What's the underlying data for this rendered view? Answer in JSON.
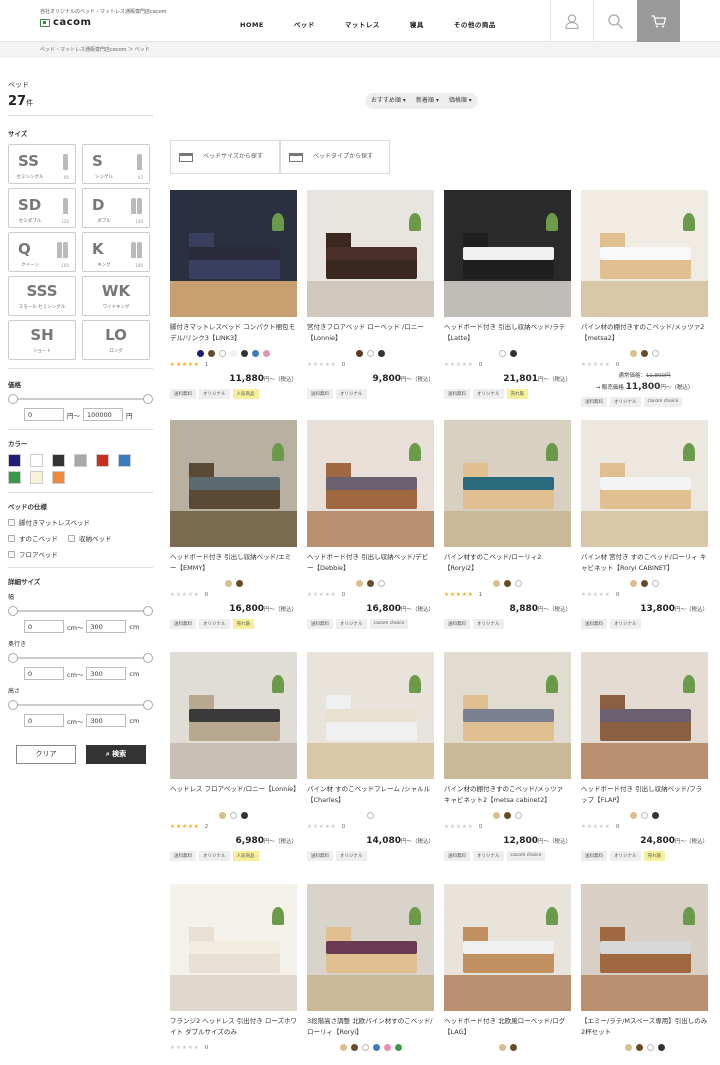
{
  "header": {
    "tagline": "自社オリジナルのベッド・マットレス通販専門店cacom",
    "logo": "cacom",
    "nav": [
      "HOME",
      "ベッド",
      "マットレス",
      "寝具",
      "その他の商品"
    ]
  },
  "breadcrumb": "ベッド・マットレス通販専門店cacom  ＞  ベッド",
  "sidebar": {
    "title": "ベッド",
    "count": "27",
    "count_unit": "件",
    "size_label": "サイズ",
    "sizes": [
      {
        "code": "SS",
        "desc": "セミシングル",
        "dim": "90",
        "people": 1
      },
      {
        "code": "S",
        "desc": "シングル",
        "dim": "97",
        "people": 1
      },
      {
        "code": "SD",
        "desc": "セミダブル",
        "dim": "120",
        "people": 1
      },
      {
        "code": "D",
        "desc": "ダブル",
        "dim": "140",
        "people": 2
      },
      {
        "code": "Q",
        "desc": "クイーン",
        "dim": "160",
        "people": 2
      },
      {
        "code": "K",
        "desc": "キング",
        "dim": "180",
        "people": 2
      },
      {
        "code": "SSS",
        "desc": "スモール セミシングル",
        "dim": "",
        "people": 0
      },
      {
        "code": "WK",
        "desc": "ワイドキング",
        "dim": "",
        "people": 0
      },
      {
        "code": "SH",
        "desc": "ショート",
        "dim": "",
        "people": 0
      },
      {
        "code": "LO",
        "desc": "ロング",
        "dim": "",
        "people": 0
      }
    ],
    "price_label": "価格",
    "price_min": "0",
    "price_sep": "円〜",
    "price_max": "100000",
    "price_unit": "円",
    "color_label": "カラー",
    "colors": [
      "#1f1f7a",
      "#ffffff",
      "#333333",
      "#a8a8a8",
      "#c83020",
      "#3a7cc0",
      "#3a9a4a",
      "#f8f2d8",
      "#f08a3a"
    ],
    "spec_label": "ベッドの仕様",
    "specs": [
      "脚付きマットレスベッド",
      "すのこベッド",
      "収納ベッド",
      "フロアベッド"
    ],
    "detail_label": "詳細サイズ",
    "dims": [
      {
        "label": "幅",
        "min": "0",
        "sep": "cm〜",
        "max": "300",
        "unit": "cm"
      },
      {
        "label": "奥行き",
        "min": "0",
        "sep": "cm〜",
        "max": "300",
        "unit": "cm"
      },
      {
        "label": "高さ",
        "min": "0",
        "sep": "cm〜",
        "max": "300",
        "unit": "cm"
      }
    ],
    "clear": "クリア",
    "search": "検索"
  },
  "sort": [
    "おすすめ順",
    "新着順",
    "価格順"
  ],
  "pills": [
    "ベッドサイズから探す",
    "ベッドタイプから探す"
  ],
  "products": [
    {
      "title": "脚付きマットレスベッド コンパクト梱包モデル/リンク3【LINK3】",
      "dots": [
        "#1f1f7a",
        "#6b4a2a",
        "#ffffff",
        "#f0f0f0",
        "#333333",
        "#3a7cc0",
        "#e890b0"
      ],
      "stars": 5,
      "reviews": "1",
      "price": "11,880",
      "tags": [
        "送料無料",
        "オリジナル",
        "人気商品"
      ],
      "room": "#2b3040",
      "floor": "#c8a070",
      "bedc": "#3a3f60",
      "matc": "#2a2a3a"
    },
    {
      "title": "宮付きフロアベッド ローベッド /ロニー【Lonnie】",
      "dots": [
        "#5a3a20",
        "#ffffff",
        "#333333"
      ],
      "stars": 0,
      "reviews": "0",
      "price": "9,800",
      "tags": [
        "送料無料",
        "オリジナル"
      ],
      "room": "#e8e4df",
      "floor": "#d0c8bd",
      "bedc": "#3a2820",
      "matc": "#4a3028"
    },
    {
      "title": "ヘッドボード付き 引出し収納ベッド/ラテ【Latte】",
      "dots": [
        "#ffffff",
        "#333333"
      ],
      "stars": 0,
      "reviews": "0",
      "price": "21,801",
      "tags": [
        "送料無料",
        "オリジナル",
        "売れ筋"
      ],
      "room": "#2a2a2a",
      "floor": "#c0bcb8",
      "bedc": "#1f1f1f",
      "matc": "#f0f0f0"
    },
    {
      "title": "パイン材の棚付きすのこベッド/メッツァ2【metsa2】",
      "dots": [
        "#d8c090",
        "#6b4a2a",
        "#ffffff"
      ],
      "stars": 0,
      "reviews": "0",
      "price": "",
      "orig_label": "通常価格：",
      "orig": "11,800円",
      "sale_label": "→ 販売価格",
      "sale": "11,800",
      "tags": [
        "送料無料",
        "オリジナル",
        "cacom choice"
      ],
      "room": "#f0ece4",
      "floor": "#d8c8a8",
      "bedc": "#e0c090",
      "matc": "#f8f8f8"
    },
    {
      "title": "ヘッドボード付き 引出し収納ベッド/エミー【EMMY】",
      "dots": [
        "#d8c090",
        "#6b4a2a"
      ],
      "stars": 0,
      "reviews": "0",
      "price": "16,800",
      "tags": [
        "送料無料",
        "オリジナル",
        "売れ筋"
      ],
      "room": "#b8b0a0",
      "floor": "#7a6a50",
      "bedc": "#5a4a35",
      "matc": "#5a6a70"
    },
    {
      "title": "ヘッドボード付き 引出し収納ベッド/デビー【Debbie】",
      "dots": [
        "#d8c090",
        "#6b4a2a",
        "#ffffff"
      ],
      "stars": 0,
      "reviews": "0",
      "price": "16,800",
      "tags": [
        "送料無料",
        "オリジナル",
        "cacom choice"
      ],
      "room": "#e8e0d8",
      "floor": "#b89070",
      "bedc": "#a06840",
      "matc": "#6a6070"
    },
    {
      "title": "パイン材すのこベッド/ローリィ2【Roryi2】",
      "dots": [
        "#d8c090",
        "#6b4a2a",
        "#ffffff"
      ],
      "stars": 5,
      "reviews": "1",
      "price": "8,880",
      "tags": [
        "送料無料",
        "オリジナル"
      ],
      "room": "#d8d0c0",
      "floor": "#c8b898",
      "bedc": "#e0c090",
      "matc": "#2a6a7a"
    },
    {
      "title": "パイン材 宮付き すのこベッド/ローリィ キャビネット【Roryi CABINET】",
      "dots": [
        "#d8c090",
        "#6b4a2a",
        "#ffffff"
      ],
      "stars": 0,
      "reviews": "0",
      "price": "13,800",
      "tags": [
        "送料無料",
        "オリジナル"
      ],
      "room": "#ece8e0",
      "floor": "#d8c8a8",
      "bedc": "#e0c090",
      "matc": "#f4f4f4"
    },
    {
      "title": "ヘッドレス フロアベッド/ロニー【Lonnie】",
      "dots": [
        "#d8c090",
        "#ffffff",
        "#333333"
      ],
      "stars": 5,
      "reviews": "2",
      "price": "6,980",
      "tags": [
        "送料無料",
        "オリジナル",
        "人気商品"
      ],
      "room": "#e0dcd6",
      "floor": "#c8c0b5",
      "bedc": "#b8a890",
      "matc": "#3a3a3a"
    },
    {
      "title": "パイン材 すのこベッドフレーム /シャルル【Charles】",
      "dots": [
        "#ffffff"
      ],
      "stars": 0,
      "reviews": "0",
      "price": "14,080",
      "tags": [
        "送料無料",
        "オリジナル"
      ],
      "room": "#e8e4dc",
      "floor": "#d8c8a8",
      "bedc": "#f0f0f0",
      "matc": "#e8e0d0"
    },
    {
      "title": "パイン材の棚付きすのこベッド/メッツァ キャビネット2【metsa cabinet2】",
      "dots": [
        "#d8c090",
        "#6b4a2a",
        "#ffffff"
      ],
      "stars": 0,
      "reviews": "0",
      "price": "12,800",
      "tags": [
        "送料無料",
        "オリジナル",
        "cacom choice"
      ],
      "room": "#e0dcd0",
      "floor": "#c8b898",
      "bedc": "#e0c090",
      "matc": "#7a8090"
    },
    {
      "title": "ヘッドボード付き 引出し収納ベッド/フラップ【FLAP】",
      "dots": [
        "#d8c090",
        "#ffffff",
        "#333333"
      ],
      "stars": 0,
      "reviews": "0",
      "price": "24,800",
      "tags": [
        "送料無料",
        "オリジナル",
        "売れ筋"
      ],
      "room": "#e4dcd2",
      "floor": "#b89070",
      "bedc": "#8a6040",
      "matc": "#6a6070"
    },
    {
      "title": "フランジ2 ヘッドレス 引出付き ローズホワイト ダブルサイズのみ",
      "dots": [],
      "stars": 0,
      "reviews": "0",
      "price": "",
      "tags": [],
      "room": "#f4f0ea",
      "floor": "#e0d8cc",
      "bedc": "#e8e0d4",
      "matc": "#f0ece0"
    },
    {
      "title": "3段階高さ調整 北欧パイン材すのこベッド/ローリィ【Roryi】",
      "dots": [
        "#d8c090",
        "#6b4a2a",
        "#ffffff",
        "#3a7cc0",
        "#e890b0",
        "#3a9a4a"
      ],
      "stars": 0,
      "reviews": "",
      "price": "",
      "tags": [],
      "room": "#d8d4cc",
      "floor": "#c8b898",
      "bedc": "#e0c090",
      "matc": "#6a3a50"
    },
    {
      "title": "ヘッドボード付き 北欧風ローベッド/ログ【LAG】",
      "dots": [
        "#d8c090",
        "#6b4a2a"
      ],
      "stars": 0,
      "reviews": "",
      "price": "",
      "tags": [],
      "room": "#e8e4dc",
      "floor": "#b89070",
      "bedc": "#c09060",
      "matc": "#f0f0f0"
    },
    {
      "title": "【エミー/ラテ/Mスペース専用】引出しのみ 2杯セット",
      "dots": [
        "#d8c090",
        "#6b4a2a",
        "#ffffff",
        "#333333"
      ],
      "stars": 0,
      "reviews": "",
      "price": "",
      "tags": [],
      "room": "#d8d0c4",
      "floor": "#b89070",
      "bedc": "#a06840",
      "matc": "#d8d8d8"
    }
  ],
  "price_suffix": "円〜（税込）"
}
